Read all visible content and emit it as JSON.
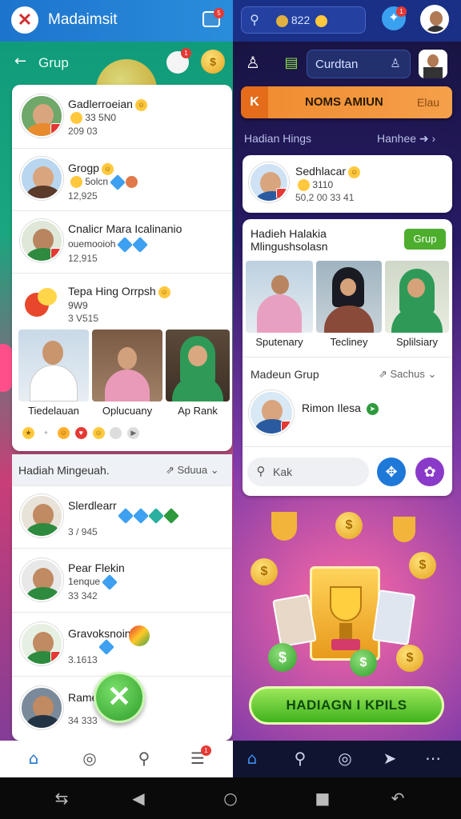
{
  "left": {
    "app_title": "Madaimsit",
    "header_badge": "5",
    "grup_title": "Grup",
    "grup_badge": "1",
    "items": [
      {
        "name": "Gadlerroeian",
        "sub": "33",
        "sub2": "5N0",
        "num": "209 03"
      },
      {
        "name": "Grogp",
        "sub": "5olcn",
        "num": "12,925"
      },
      {
        "name": "Cnalicr Mara Icalinanio",
        "sub": "ouemooioh",
        "num": "12,915"
      },
      {
        "name": "Tepa Hing Orrpsh",
        "sub": "9W9",
        "num": "3 V515"
      }
    ],
    "photo_labels": [
      "Tiedelauan",
      "Oplucuany",
      "Ap Rank"
    ],
    "section2_title": "Hadiah Mingeuah.",
    "section2_action": "Sduua",
    "items2": [
      {
        "name": "Slerdlearr",
        "num": "3 / 945"
      },
      {
        "name": "Pear Flekin",
        "sub": "1enque",
        "num": "33 342"
      },
      {
        "name": "Gravoksnoin",
        "num": "3.1613"
      },
      {
        "name": "Rame",
        "num": "34 333"
      }
    ],
    "nav": [
      "home-icon",
      "history-icon",
      "search-icon",
      "menu-icon"
    ],
    "nav_badge": "1"
  },
  "right": {
    "search_text": "822",
    "twitter_badge": "1",
    "tab_label": "Curdtan",
    "banner_k": "K",
    "banner_title": "NOMS AMIUN",
    "banner_right": "Elau",
    "section_title": "Hadian Hings",
    "section_action": "Hanhee",
    "feature": {
      "name": "Sedhlacar",
      "sub": "3110",
      "num": "50,2 00 33 41"
    },
    "group_card": {
      "title": "Hadieh Halakia Mlingushsolasn",
      "button": "Grup",
      "labels": [
        "Sputenary",
        "Tecliney",
        "Splilsiary"
      ]
    },
    "madeun_title": "Madeun Grup",
    "madeun_action": "Sachus",
    "member_name": "Rimon Ilesa",
    "search_placeholder": "Kak",
    "cta": "HADIAGN I KPILS",
    "nav": [
      "home-icon",
      "search-icon",
      "target-icon",
      "send-icon",
      "more-icon"
    ]
  },
  "colors": {
    "primary": "#1d74cc",
    "accent_green": "#3fb21c",
    "banner_orange": "#f08a2e"
  }
}
